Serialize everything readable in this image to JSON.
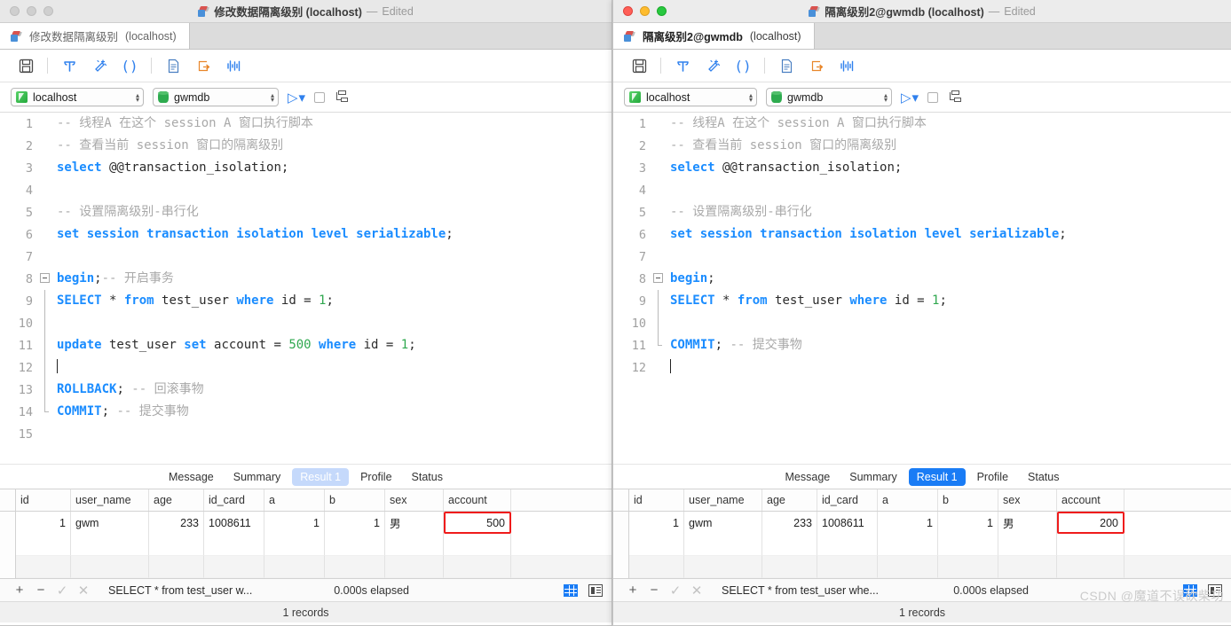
{
  "windows": [
    {
      "id": "left",
      "active": false,
      "titlebar": {
        "title": "修改数据隔离级别 (localhost)",
        "separator": "—",
        "edited": "Edited",
        "icon": "navicat-icon",
        "buttons": [
          "close",
          "minimize",
          "maximize"
        ]
      },
      "doc_tab": {
        "label": "修改数据隔离级别",
        "sub": "(localhost)",
        "icon": "database-tab-icon"
      },
      "toolbar": [
        {
          "name": "save-icon",
          "glyph": "💾"
        },
        {
          "name": "beautify-icon",
          "glyph": "┴"
        },
        {
          "name": "format-icon",
          "glyph": "✳"
        },
        {
          "name": "parentheses-icon",
          "glyph": "()"
        },
        {
          "name": "snippet-icon",
          "glyph": "🗎"
        },
        {
          "name": "export-icon",
          "glyph": "↳"
        },
        {
          "name": "explain-icon",
          "glyph": "‖"
        }
      ],
      "connection": {
        "server": "localhost",
        "database": "gwmdb",
        "run_label": "▷",
        "run_caret": "▾"
      },
      "code": [
        {
          "n": 1,
          "fold": "none",
          "tokens": [
            {
              "t": "-- 线程A 在这个 session A 窗口执行脚本",
              "c": "cm"
            }
          ]
        },
        {
          "n": 2,
          "fold": "none",
          "tokens": [
            {
              "t": "-- 查看当前 session 窗口的隔离级别",
              "c": "cm"
            }
          ]
        },
        {
          "n": 3,
          "fold": "none",
          "tokens": [
            {
              "t": "select",
              "c": "kw"
            },
            {
              "t": " @@transaction_isolation;",
              "c": "pl"
            }
          ]
        },
        {
          "n": 4,
          "fold": "none",
          "tokens": []
        },
        {
          "n": 5,
          "fold": "none",
          "tokens": [
            {
              "t": "-- 设置隔离级别-串行化",
              "c": "cm"
            }
          ]
        },
        {
          "n": 6,
          "fold": "none",
          "tokens": [
            {
              "t": "set session transaction isolation level serializable",
              "c": "kw"
            },
            {
              "t": ";",
              "c": "pl"
            }
          ]
        },
        {
          "n": 7,
          "fold": "none",
          "tokens": []
        },
        {
          "n": 8,
          "fold": "start",
          "tokens": [
            {
              "t": "begin",
              "c": "kw"
            },
            {
              "t": ";",
              "c": "pl"
            },
            {
              "t": "-- 开启事务",
              "c": "cm"
            }
          ]
        },
        {
          "n": 9,
          "fold": "mid",
          "tokens": [
            {
              "t": "SELECT",
              "c": "kw"
            },
            {
              "t": " * ",
              "c": "pl"
            },
            {
              "t": "from",
              "c": "kw"
            },
            {
              "t": " test_user ",
              "c": "pl"
            },
            {
              "t": "where",
              "c": "kw"
            },
            {
              "t": " id = ",
              "c": "pl"
            },
            {
              "t": "1",
              "c": "num"
            },
            {
              "t": ";",
              "c": "pl"
            }
          ]
        },
        {
          "n": 10,
          "fold": "mid",
          "tokens": []
        },
        {
          "n": 11,
          "fold": "mid",
          "tokens": [
            {
              "t": "update",
              "c": "kw"
            },
            {
              "t": " test_user ",
              "c": "pl"
            },
            {
              "t": "set",
              "c": "kw"
            },
            {
              "t": " account = ",
              "c": "pl"
            },
            {
              "t": "500",
              "c": "num"
            },
            {
              "t": " ",
              "c": "pl"
            },
            {
              "t": "where",
              "c": "kw"
            },
            {
              "t": " id = ",
              "c": "pl"
            },
            {
              "t": "1",
              "c": "num"
            },
            {
              "t": ";",
              "c": "pl"
            }
          ]
        },
        {
          "n": 12,
          "fold": "mid",
          "caret": true,
          "tokens": []
        },
        {
          "n": 13,
          "fold": "mid",
          "tokens": [
            {
              "t": "ROLLBACK",
              "c": "kw"
            },
            {
              "t": "; ",
              "c": "pl"
            },
            {
              "t": "-- 回滚事物",
              "c": "cm"
            }
          ]
        },
        {
          "n": 14,
          "fold": "end",
          "tokens": [
            {
              "t": "COMMIT",
              "c": "kw"
            },
            {
              "t": "; ",
              "c": "pl"
            },
            {
              "t": "-- 提交事物",
              "c": "cm"
            }
          ]
        },
        {
          "n": 15,
          "fold": "none",
          "tokens": []
        }
      ],
      "result_tabs": [
        {
          "label": "Message",
          "state": "normal"
        },
        {
          "label": "Summary",
          "state": "normal"
        },
        {
          "label": "Result 1",
          "state": "selected-inactive"
        },
        {
          "label": "Profile",
          "state": "normal"
        },
        {
          "label": "Status",
          "state": "normal"
        }
      ],
      "grid": {
        "columns": [
          "id",
          "user_name",
          "age",
          "id_card",
          "a",
          "b",
          "sex",
          "account"
        ],
        "rows": [
          {
            "id": "1",
            "user_name": "gwm",
            "age": "233",
            "id_card": "1008611",
            "a": "1",
            "b": "1",
            "sex": "男",
            "account": "500"
          }
        ],
        "highlight_column": "account"
      },
      "bottom": {
        "add": "+",
        "remove": "−",
        "confirm": "✓",
        "cancel": "✕",
        "sql": "SELECT * from test_user w...",
        "elapsed": "0.000s elapsed",
        "grid_view_icon": "grid-view-icon",
        "form_view_icon": "form-view-icon",
        "records": "1 records"
      }
    },
    {
      "id": "right",
      "active": true,
      "titlebar": {
        "title": "隔离级别2@gwmdb (localhost)",
        "separator": "—",
        "edited": "Edited",
        "icon": "navicat-icon",
        "buttons": [
          "close",
          "minimize",
          "maximize"
        ]
      },
      "doc_tab": {
        "label": "隔离级别2@gwmdb",
        "sub": "(localhost)",
        "icon": "database-tab-icon"
      },
      "toolbar": [
        {
          "name": "save-icon",
          "glyph": "💾"
        },
        {
          "name": "beautify-icon",
          "glyph": "┴"
        },
        {
          "name": "format-icon",
          "glyph": "✳"
        },
        {
          "name": "parentheses-icon",
          "glyph": "()"
        },
        {
          "name": "snippet-icon",
          "glyph": "🗎"
        },
        {
          "name": "export-icon",
          "glyph": "↳"
        },
        {
          "name": "explain-icon",
          "glyph": "‖"
        }
      ],
      "connection": {
        "server": "localhost",
        "database": "gwmdb",
        "run_label": "▷",
        "run_caret": "▾"
      },
      "code": [
        {
          "n": 1,
          "fold": "none",
          "tokens": [
            {
              "t": "-- 线程A 在这个 session A 窗口执行脚本",
              "c": "cm"
            }
          ]
        },
        {
          "n": 2,
          "fold": "none",
          "tokens": [
            {
              "t": "-- 查看当前 session 窗口的隔离级别",
              "c": "cm"
            }
          ]
        },
        {
          "n": 3,
          "fold": "none",
          "tokens": [
            {
              "t": "select",
              "c": "kw"
            },
            {
              "t": " @@transaction_isolation;",
              "c": "pl"
            }
          ]
        },
        {
          "n": 4,
          "fold": "none",
          "tokens": []
        },
        {
          "n": 5,
          "fold": "none",
          "tokens": [
            {
              "t": "-- 设置隔离级别-串行化",
              "c": "cm"
            }
          ]
        },
        {
          "n": 6,
          "fold": "none",
          "tokens": [
            {
              "t": "set session transaction isolation level serializable",
              "c": "kw"
            },
            {
              "t": ";",
              "c": "pl"
            }
          ]
        },
        {
          "n": 7,
          "fold": "none",
          "tokens": []
        },
        {
          "n": 8,
          "fold": "start",
          "tokens": [
            {
              "t": "begin",
              "c": "kw"
            },
            {
              "t": ";",
              "c": "pl"
            }
          ]
        },
        {
          "n": 9,
          "fold": "mid",
          "tokens": [
            {
              "t": "SELECT",
              "c": "kw"
            },
            {
              "t": " * ",
              "c": "pl"
            },
            {
              "t": "from",
              "c": "kw"
            },
            {
              "t": " test_user ",
              "c": "pl"
            },
            {
              "t": "where",
              "c": "kw"
            },
            {
              "t": " id = ",
              "c": "pl"
            },
            {
              "t": "1",
              "c": "num"
            },
            {
              "t": ";",
              "c": "pl"
            }
          ]
        },
        {
          "n": 10,
          "fold": "mid",
          "tokens": []
        },
        {
          "n": 11,
          "fold": "end",
          "tokens": [
            {
              "t": "COMMIT",
              "c": "kw"
            },
            {
              "t": "; ",
              "c": "pl"
            },
            {
              "t": "-- 提交事物",
              "c": "cm"
            }
          ]
        },
        {
          "n": 12,
          "fold": "none",
          "caret": true,
          "tokens": []
        }
      ],
      "result_tabs": [
        {
          "label": "Message",
          "state": "normal"
        },
        {
          "label": "Summary",
          "state": "normal"
        },
        {
          "label": "Result 1",
          "state": "selected-active"
        },
        {
          "label": "Profile",
          "state": "normal"
        },
        {
          "label": "Status",
          "state": "normal"
        }
      ],
      "grid": {
        "columns": [
          "id",
          "user_name",
          "age",
          "id_card",
          "a",
          "b",
          "sex",
          "account"
        ],
        "rows": [
          {
            "id": "1",
            "user_name": "gwm",
            "age": "233",
            "id_card": "1008611",
            "a": "1",
            "b": "1",
            "sex": "男",
            "account": "200"
          }
        ],
        "highlight_column": "account"
      },
      "bottom": {
        "add": "+",
        "remove": "−",
        "confirm": "✓",
        "cancel": "✕",
        "sql": "SELECT * from test_user whe...",
        "elapsed": "0.000s elapsed",
        "grid_view_icon": "grid-view-icon",
        "form_view_icon": "form-view-icon",
        "records": "1 records"
      }
    }
  ],
  "watermark": "CSDN @魔道不误砍柴功",
  "colors": {
    "accent_blue": "#1a7cf5",
    "tab_inactive_blue": "#c5d9fb",
    "keyword_blue": "#1a8cff",
    "comment_gray": "#a9a9a9",
    "number_green": "#2fa84f",
    "highlight_red": "#ef1c1c"
  }
}
